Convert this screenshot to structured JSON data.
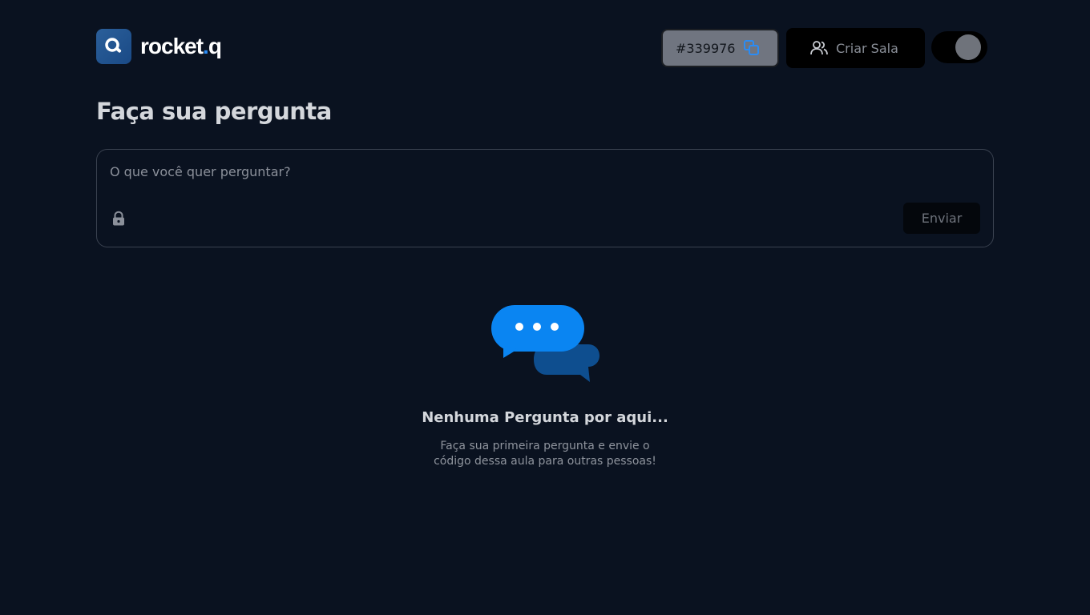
{
  "header": {
    "logo_text": "rocket",
    "logo_dot": ".",
    "logo_suffix": "q",
    "room_code": "#339976",
    "create_room_label": "Criar Sala"
  },
  "main": {
    "title": "Faça sua pergunta",
    "question_placeholder": "O que você quer perguntar?",
    "send_label": "Enviar"
  },
  "empty_state": {
    "title": "Nenhuma Pergunta por aqui...",
    "description": "Faça sua primeira pergunta e envie o código dessa aula para outras pessoas!"
  },
  "icons": {
    "logo": "search-bubble-icon",
    "copy": "copy-icon",
    "users": "users-icon",
    "lock": "lock-icon",
    "chat": "chat-bubbles-icon"
  },
  "colors": {
    "background": "#0a1220",
    "accent": "#2a8cf5",
    "bubble_dark": "#0e4e8f"
  },
  "theme_toggle": {
    "dark_mode": true
  }
}
